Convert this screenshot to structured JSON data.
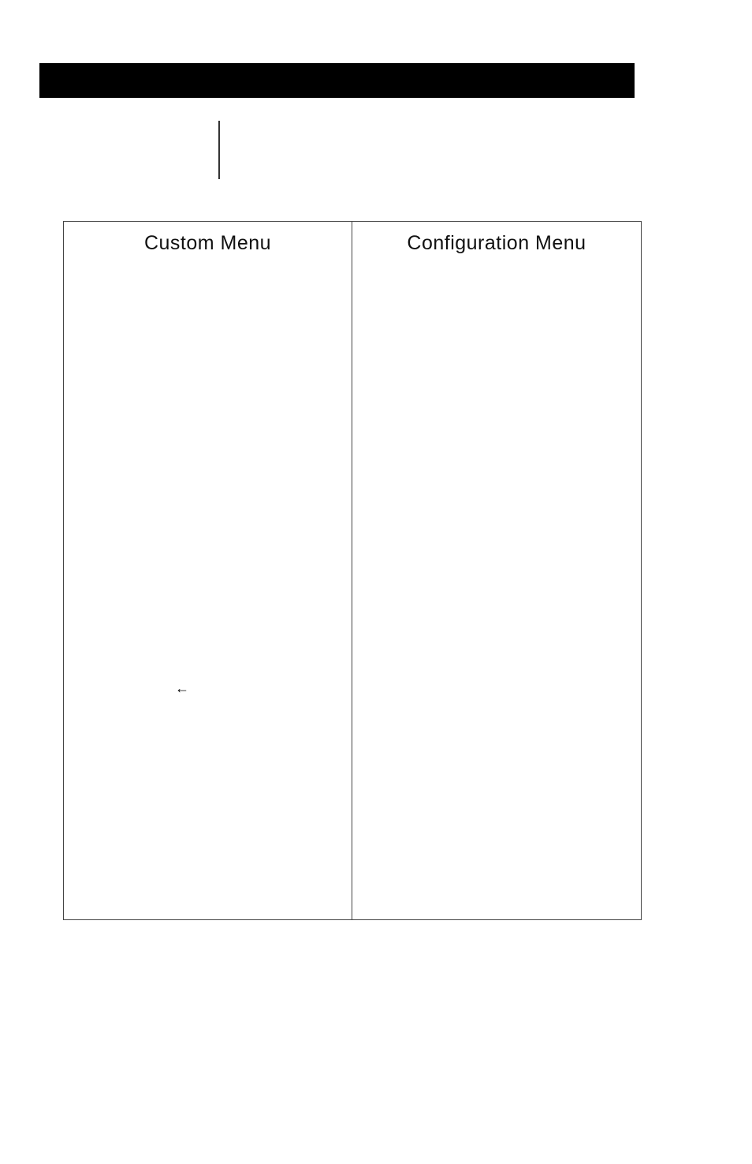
{
  "table": {
    "left_header": "Custom Menu",
    "right_header": "Configuration Menu",
    "arrow_glyph": "←"
  }
}
